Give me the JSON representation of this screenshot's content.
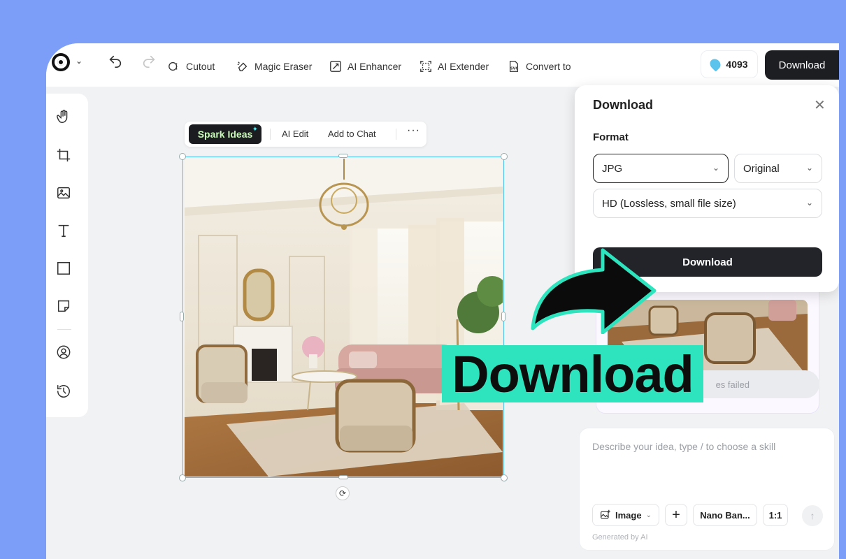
{
  "toolbar": {
    "tools": [
      {
        "label": "Cutout",
        "icon": "cutout-icon"
      },
      {
        "label": "Magic Eraser",
        "icon": "eraser-icon"
      },
      {
        "label": "AI Enhancer",
        "icon": "enhancer-icon"
      },
      {
        "label": "AI Extender",
        "icon": "extender-icon"
      },
      {
        "label": "Convert to",
        "icon": "svg-icon"
      }
    ],
    "credits": "4093",
    "download_label": "Download"
  },
  "left_tools": [
    "hand-icon",
    "crop-icon",
    "image-icon",
    "text-icon",
    "shape-icon",
    "sticker-icon",
    "avatar-icon",
    "history-icon"
  ],
  "canvas_toolbar": {
    "spark_label": "Spark Ideas",
    "ai_edit_label": "AI Edit",
    "add_to_chat_label": "Add to Chat",
    "more_label": "···"
  },
  "dialog": {
    "title": "Download",
    "format_label": "Format",
    "format_value": "JPG",
    "size_value": "Original",
    "quality_value": "HD (Lossless, small file size)",
    "button_label": "Download"
  },
  "panel": {
    "failed_text": "es failed",
    "chat_placeholder": "Describe your idea, type / to choose a skill",
    "chips": {
      "image": "Image",
      "model": "Nano Ban...",
      "ratio": "1:1"
    },
    "generated_by": "Generated by AI"
  },
  "overlay": {
    "label": "Download"
  },
  "colors": {
    "background": "#7d9ef8",
    "accent": "#2ee4be",
    "selection": "#4ec0e6",
    "dark": "#1d1e22"
  }
}
